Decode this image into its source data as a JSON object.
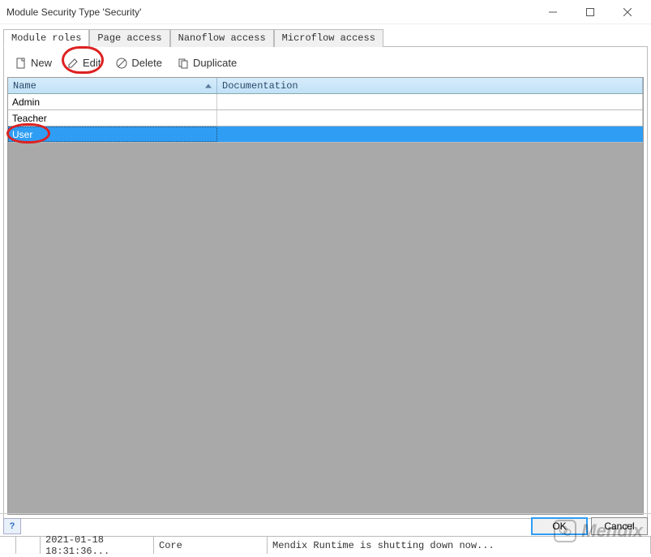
{
  "window": {
    "title": "Module Security Type 'Security'"
  },
  "tabs": {
    "module_roles": "Module roles",
    "page_access": "Page access",
    "nanoflow_access": "Nanoflow access",
    "microflow_access": "Microflow access"
  },
  "toolbar": {
    "new_label": "New",
    "edit_label": "Edit",
    "delete_label": "Delete",
    "duplicate_label": "Duplicate"
  },
  "table": {
    "headers": {
      "name": "Name",
      "documentation": "Documentation"
    },
    "rows": [
      {
        "name": "Admin",
        "doc": "",
        "selected": false
      },
      {
        "name": "Teacher",
        "doc": "",
        "selected": false
      },
      {
        "name": "User",
        "doc": "",
        "selected": true
      }
    ]
  },
  "footer": {
    "help": "?",
    "ok": "OK",
    "cancel": "Cancel"
  },
  "status": {
    "timestamp": "2021-01-18 18:31:36...",
    "module": "Core",
    "message": "Mendix Runtime is shutting down now..."
  },
  "watermark": "Mendix"
}
